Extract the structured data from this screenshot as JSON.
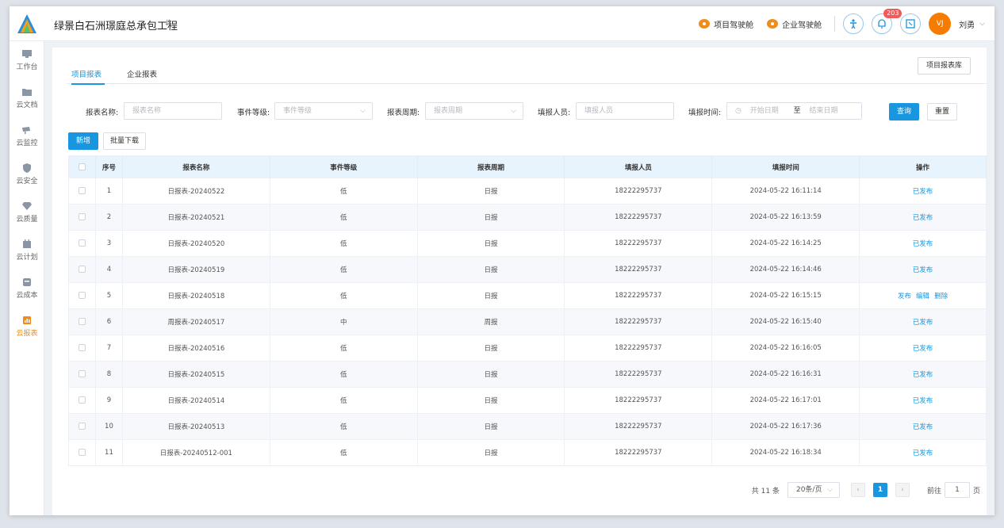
{
  "project": {
    "title": "绿景白石洲璟庭总承包工程",
    "switch_icon": "swap-icon"
  },
  "header": {
    "project_cockpit": "项目驾驶舱",
    "company_cockpit": "企业驾驶舱",
    "notification_count": "203",
    "avatar_text": "VJ",
    "user_name": "刘勇"
  },
  "sidebar": {
    "items": [
      {
        "label": "工作台",
        "icon": "monitor-icon"
      },
      {
        "label": "云文档",
        "icon": "folder-icon"
      },
      {
        "label": "云监控",
        "icon": "camera-icon"
      },
      {
        "label": "云安全",
        "icon": "shield-icon"
      },
      {
        "label": "云质量",
        "icon": "diamond-icon"
      },
      {
        "label": "云计划",
        "icon": "calendar-icon"
      },
      {
        "label": "云成本",
        "icon": "coin-icon"
      },
      {
        "label": "云报表",
        "icon": "report-icon",
        "active": true
      }
    ]
  },
  "tabs": {
    "project_report": "项目报表",
    "company_report": "企业报表",
    "report_library": "项目报表库"
  },
  "filters": {
    "name_label": "报表名称:",
    "name_placeholder": "报表名称",
    "level_label": "事件等级:",
    "level_placeholder": "事件等级",
    "period_label": "报表周期:",
    "period_placeholder": "报表周期",
    "filler_label": "填报人员:",
    "filler_placeholder": "填报人员",
    "time_label": "填报时间:",
    "start_placeholder": "开始日期",
    "to": "至",
    "end_placeholder": "结束日期",
    "search": "查询",
    "reset": "重置"
  },
  "actions": {
    "add": "新增",
    "batch_download": "批量下载"
  },
  "table": {
    "headers": {
      "no": "序号",
      "name": "报表名称",
      "level": "事件等级",
      "period": "报表周期",
      "filler": "填报人员",
      "time": "填报时间",
      "ops": "操作"
    },
    "rows": [
      {
        "no": "1",
        "name": "日报表-20240522",
        "level": "低",
        "period": "日报",
        "filler": "18222295737",
        "time": "2024-05-22 16:11:14",
        "ops": [
          "已发布"
        ]
      },
      {
        "no": "2",
        "name": "日报表-20240521",
        "level": "低",
        "period": "日报",
        "filler": "18222295737",
        "time": "2024-05-22 16:13:59",
        "ops": [
          "已发布"
        ]
      },
      {
        "no": "3",
        "name": "日报表-20240520",
        "level": "低",
        "period": "日报",
        "filler": "18222295737",
        "time": "2024-05-22 16:14:25",
        "ops": [
          "已发布"
        ]
      },
      {
        "no": "4",
        "name": "日报表-20240519",
        "level": "低",
        "period": "日报",
        "filler": "18222295737",
        "time": "2024-05-22 16:14:46",
        "ops": [
          "已发布"
        ]
      },
      {
        "no": "5",
        "name": "日报表-20240518",
        "level": "低",
        "period": "日报",
        "filler": "18222295737",
        "time": "2024-05-22 16:15:15",
        "ops": [
          "发布",
          "编辑",
          "删除"
        ]
      },
      {
        "no": "6",
        "name": "周报表-20240517",
        "level": "中",
        "period": "周报",
        "filler": "18222295737",
        "time": "2024-05-22 16:15:40",
        "ops": [
          "已发布"
        ]
      },
      {
        "no": "7",
        "name": "日报表-20240516",
        "level": "低",
        "period": "日报",
        "filler": "18222295737",
        "time": "2024-05-22 16:16:05",
        "ops": [
          "已发布"
        ]
      },
      {
        "no": "8",
        "name": "日报表-20240515",
        "level": "低",
        "period": "日报",
        "filler": "18222295737",
        "time": "2024-05-22 16:16:31",
        "ops": [
          "已发布"
        ]
      },
      {
        "no": "9",
        "name": "日报表-20240514",
        "level": "低",
        "period": "日报",
        "filler": "18222295737",
        "time": "2024-05-22 16:17:01",
        "ops": [
          "已发布"
        ]
      },
      {
        "no": "10",
        "name": "日报表-20240513",
        "level": "低",
        "period": "日报",
        "filler": "18222295737",
        "time": "2024-05-22 16:17:36",
        "ops": [
          "已发布"
        ]
      },
      {
        "no": "11",
        "name": "日报表-20240512-001",
        "level": "低",
        "period": "日报",
        "filler": "18222295737",
        "time": "2024-05-22 16:18:34",
        "ops": [
          "已发布"
        ]
      }
    ]
  },
  "pagination": {
    "total": "共 11 条",
    "page_size": "20条/页",
    "current": "1",
    "goto_prefix": "前往",
    "goto_value": "1",
    "goto_suffix": "页"
  },
  "colors": {
    "primary": "#1896e0",
    "accent": "#f08c1a",
    "badge": "#f05a5a"
  }
}
